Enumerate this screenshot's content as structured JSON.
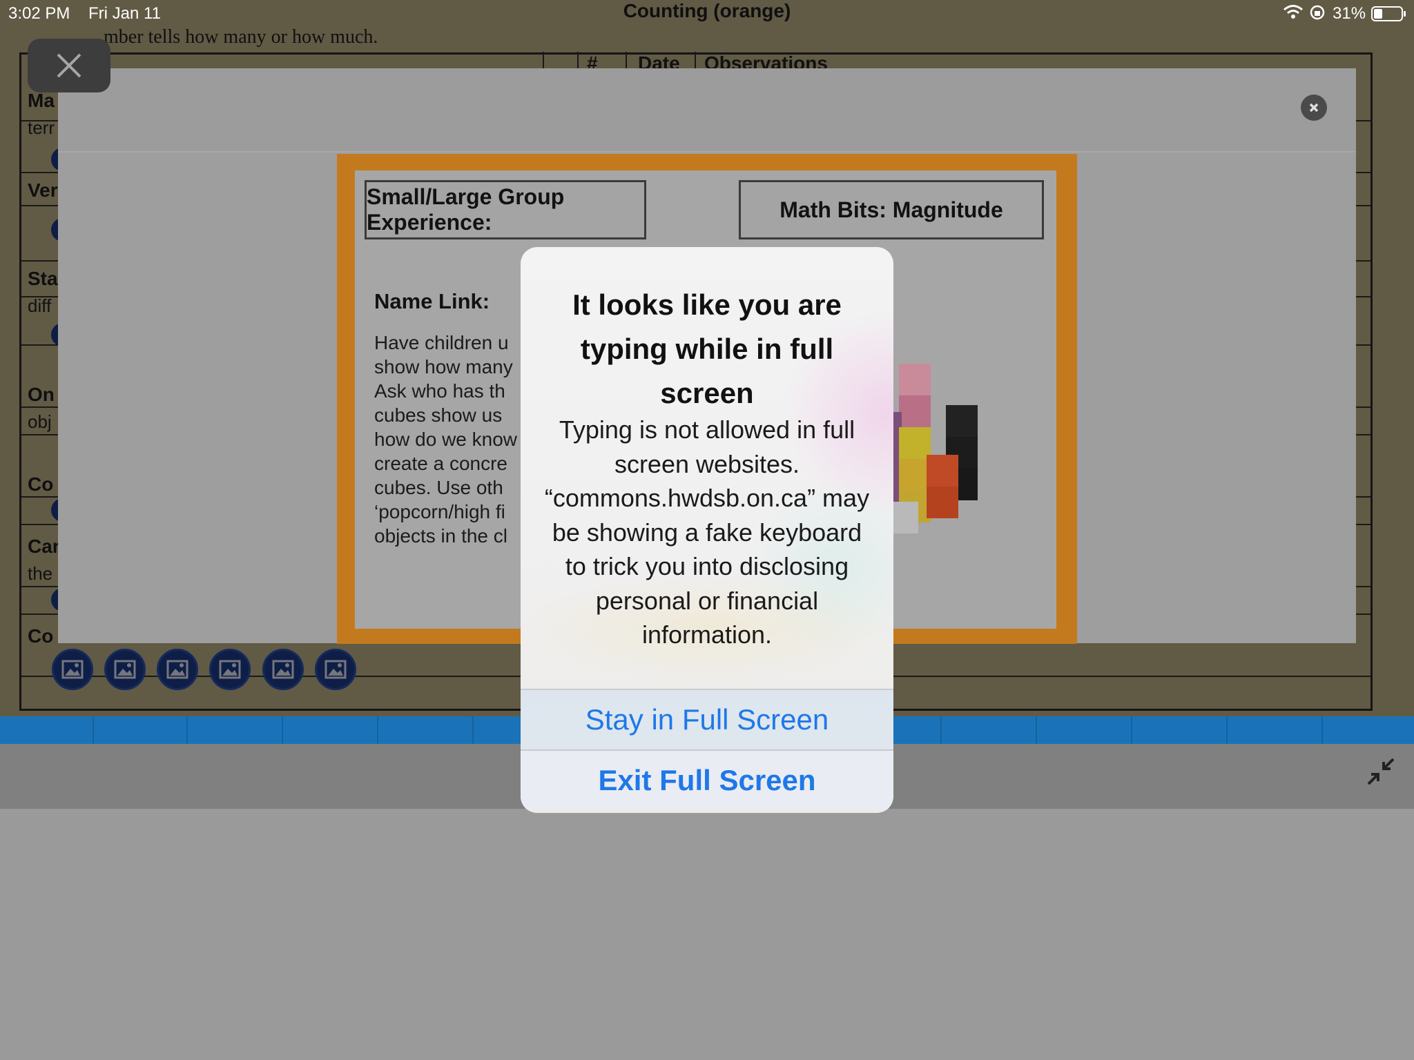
{
  "status_bar": {
    "time": "3:02 PM",
    "date": "Fri Jan 11",
    "battery": "31%"
  },
  "document": {
    "title": "Counting (orange)",
    "subtitle": "mber tells how many or how much.",
    "header_cols": [
      "#",
      "Date",
      "Observations"
    ],
    "rows": [
      {
        "label": "Ma",
        "sub": "terr"
      },
      {
        "label": "Ver",
        "sub": ""
      },
      {
        "label": "Sta",
        "sub": "diff"
      },
      {
        "label": "On",
        "sub": "obj"
      },
      {
        "label": "Co",
        "sub": ""
      },
      {
        "label": "Car",
        "sub": "the"
      },
      {
        "label": "Co",
        "sub": ""
      }
    ],
    "image_buttons": [
      "image-icon",
      "image-icon",
      "image-icon",
      "image-icon",
      "image-icon",
      "image-icon"
    ]
  },
  "lightbox": {
    "left_box": "Small/Large Group Experience:",
    "right_box": "Math Bits: Magnitude",
    "name_link": "Name Link:",
    "body_lines": [
      "Have children u",
      "show how many",
      "Ask who has th",
      "cubes show us",
      "how do we know",
      "create a concre",
      "cubes.  Use oth",
      "‘popcorn/high fi",
      "objects in the cl"
    ]
  },
  "alert": {
    "title": "It looks like you are typing while in full screen",
    "message": "Typing is not allowed in full screen websites. “commons.hwdsb.on.ca” may be showing a fake keyboard to trick you into disclosing personal or financial information.",
    "stay_label": "Stay in Full Screen",
    "exit_label": "Exit Full Screen"
  },
  "colors": {
    "accent": "#1e78e8",
    "card_border": "#c37a1f",
    "bar_blue": "#1a73b8"
  }
}
